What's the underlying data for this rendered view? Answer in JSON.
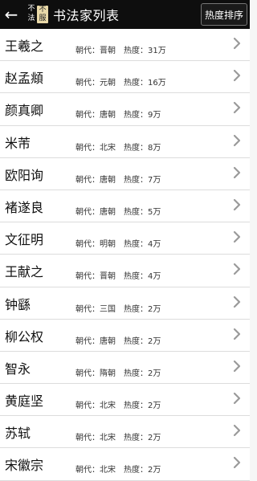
{
  "appbar": {
    "back_icon": "arrow-left-icon",
    "logo_text": [
      "不",
      "法",
      "不",
      "服"
    ],
    "title": "书法家列表",
    "sort_label": "热度排序"
  },
  "labels": {
    "dynasty": "朝代：",
    "heat": "热度："
  },
  "items": [
    {
      "name": "王羲之",
      "dynasty": "晋朝",
      "heat": "31万"
    },
    {
      "name": "赵孟頫",
      "dynasty": "元朝",
      "heat": "16万"
    },
    {
      "name": "颜真卿",
      "dynasty": "唐朝",
      "heat": "9万"
    },
    {
      "name": "米芾",
      "dynasty": "北宋",
      "heat": "8万"
    },
    {
      "name": "欧阳询",
      "dynasty": "唐朝",
      "heat": "7万"
    },
    {
      "name": "褚遂良",
      "dynasty": "唐朝",
      "heat": "5万"
    },
    {
      "name": "文征明",
      "dynasty": "明朝",
      "heat": "4万"
    },
    {
      "name": "王献之",
      "dynasty": "晋朝",
      "heat": "4万"
    },
    {
      "name": "钟繇",
      "dynasty": "三国",
      "heat": "2万"
    },
    {
      "name": "柳公权",
      "dynasty": "唐朝",
      "heat": "2万"
    },
    {
      "name": "智永",
      "dynasty": "隋朝",
      "heat": "2万"
    },
    {
      "name": "黄庭坚",
      "dynasty": "北宋",
      "heat": "2万"
    },
    {
      "name": "苏轼",
      "dynasty": "北宋",
      "heat": "2万"
    },
    {
      "name": "宋徽宗",
      "dynasty": "北宋",
      "heat": "2万"
    }
  ]
}
